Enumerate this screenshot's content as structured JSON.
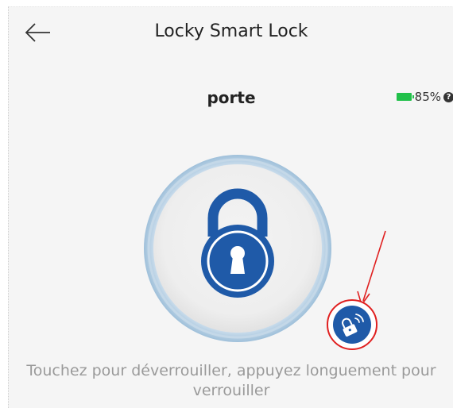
{
  "header": {
    "title": "Locky Smart Lock",
    "back_icon": "arrow-left-icon"
  },
  "device": {
    "name": "porte",
    "battery_percent_label": "85%",
    "battery_level": 0.85,
    "help_glyph": "?"
  },
  "lock": {
    "icon": "padlock-icon",
    "state": "locked"
  },
  "remote": {
    "icon": "remote-unlock-icon"
  },
  "hint": {
    "text": "Touchez pour déverrouiller, appuyez longuement pour verrouiller"
  },
  "colors": {
    "background": "#f5f5f5",
    "accent_blue": "#1f5aa8",
    "battery_green": "#21c04a",
    "annotation_red": "#e02020",
    "hint_gray": "#9a9a9a"
  }
}
